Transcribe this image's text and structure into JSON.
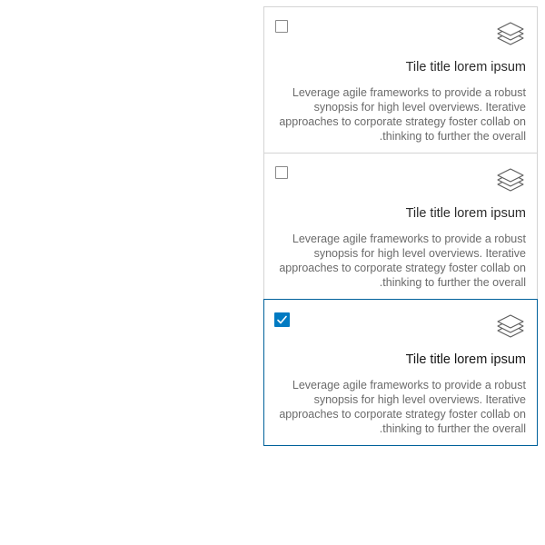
{
  "tiles": [
    {
      "title": "Tile title lorem ipsum",
      "description_lines": [
        "Leverage agile frameworks to provide a robust",
        "synopsis for high level overviews. Iterative",
        "approaches to corporate strategy foster collab on",
        ".thinking to further the overall"
      ],
      "checked": false,
      "icon": "layers-icon"
    },
    {
      "title": "Tile title lorem ipsum",
      "description_lines": [
        "Leverage agile frameworks to provide a robust",
        "synopsis for high level overviews. Iterative",
        "approaches to corporate strategy foster collab on",
        ".thinking to further the overall"
      ],
      "checked": false,
      "icon": "layers-icon"
    },
    {
      "title": "Tile title lorem ipsum",
      "description_lines": [
        "Leverage agile frameworks to provide a robust",
        "synopsis for high level overviews. Iterative",
        "approaches to corporate strategy foster collab on",
        ".thinking to further the overall"
      ],
      "checked": true,
      "icon": "layers-icon"
    }
  ],
  "colors": {
    "accent": "#007ac2",
    "selected_border": "#00619b",
    "border": "#d4d4d4",
    "title_text": "#2b2b2b",
    "description_text": "#6a6a6a"
  }
}
